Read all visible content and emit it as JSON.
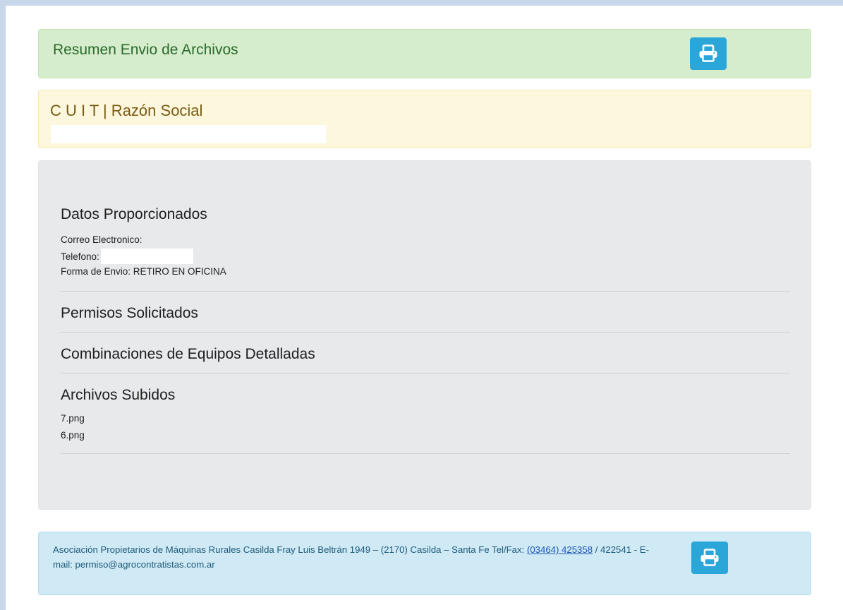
{
  "header": {
    "title": "Resumen Envio de Archivos",
    "print_icon": "print-icon"
  },
  "company": {
    "title": "C U I T | Razón Social"
  },
  "details": {
    "datos_title": "Datos Proporcionados",
    "correo_label": "Correo Electronico:",
    "telefono_label": "Telefono:",
    "forma_envio": "Forma de Envio: RETIRO EN OFICINA",
    "permisos_title": "Permisos Solicitados",
    "combinaciones_title": "Combinaciones de Equipos Detalladas",
    "archivos_title": "Archivos Subidos",
    "files": [
      "7.png",
      "6.png"
    ]
  },
  "footer": {
    "text_before": "Asociación Propietarios de Máquinas Rurales Casilda Fray Luis Beltrán 1949 – (2170) Casilda – Santa Fe Tel/Fax: ",
    "phone_link": "(03464) 425358",
    "text_after": " / 422541 - E-mail: permiso@agrocontratistas.com.ar",
    "print_icon": "print-icon"
  },
  "colors": {
    "success_bg": "#d6edcd",
    "warning_bg": "#fcf7dd",
    "info_bg": "#cfe9f5",
    "print_button": "#2aa6d8"
  }
}
